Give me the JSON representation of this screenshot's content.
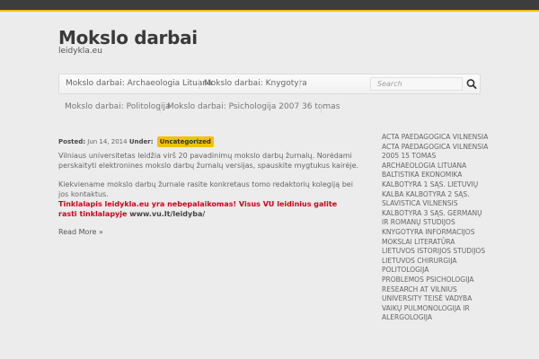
{
  "site": {
    "title": "Mokslo darbai",
    "description": "leidykla.eu"
  },
  "nav": {
    "items": [
      "Mokslo darbai: Archaeologia Lituana",
      "Mokslo darbai: Knygotyra"
    ],
    "search_placeholder": "Search"
  },
  "subnav": {
    "items": [
      "Mokslo darbai: Politologija",
      "Mokslo darbai: Psichologija 2007 36 tomas"
    ]
  },
  "post": {
    "posted_label": "Posted:",
    "date": "Jun 14, 2014",
    "under_label": "Under:",
    "category": "Uncategorized",
    "paragraph1": "Vilniaus universitetas leidžia virš 20 pavadinimų mokslo darbų žurnalų. Norėdami perskaityti elektronines mokslo darbų žurnalų versijas, spauskite mygtukus kairėje.",
    "paragraph2": "Kiekviename mokslo darbų žurnale rasite konkretaus tomo redaktorių kolegiją bei jos kontaktus.",
    "notice_red": "Tinklalapis leidykla.eu yra nebepalaikomas! Visus VU leidinius galite rasti tinklalapyje",
    "notice_link": "www.vu.lt/leidyba/",
    "read_more": "Read More »"
  },
  "sidebar": {
    "links": [
      "ACTA PAEDAGOGICA VILNENSIA",
      "ACTA PAEDAGOGICA VILNENSIA 2005 15 TOMAS",
      "ARCHAEOLOGIA LITUANA",
      "BALTISTIKA EKONOMIKA",
      "KALBOTYRA 1 SĄS. LIETUVIŲ KALBA KALBOTYRA 2 SĄS.",
      "SLAVISTICA VILNENSIS",
      "KALBOTYRA 3 SĄS. GERMANŲ IR ROMANŲ STUDIJOS",
      "KNYGOTYRA INFORMACIJOS",
      "MOKSLAI LITERATŪRA LIETUVOS ISTORIJOS STUDIJOS LIETUVOS CHIRURGIJA POLITOLOGIJA",
      "PROBLEMOS PSICHOLOGIJA RESEARCH AT VILNIUS UNIVERSITY TEISĖ VADYBA",
      "VAIKŲ PULMONOLOGIJA IR ALERGOLOGIJA"
    ]
  }
}
